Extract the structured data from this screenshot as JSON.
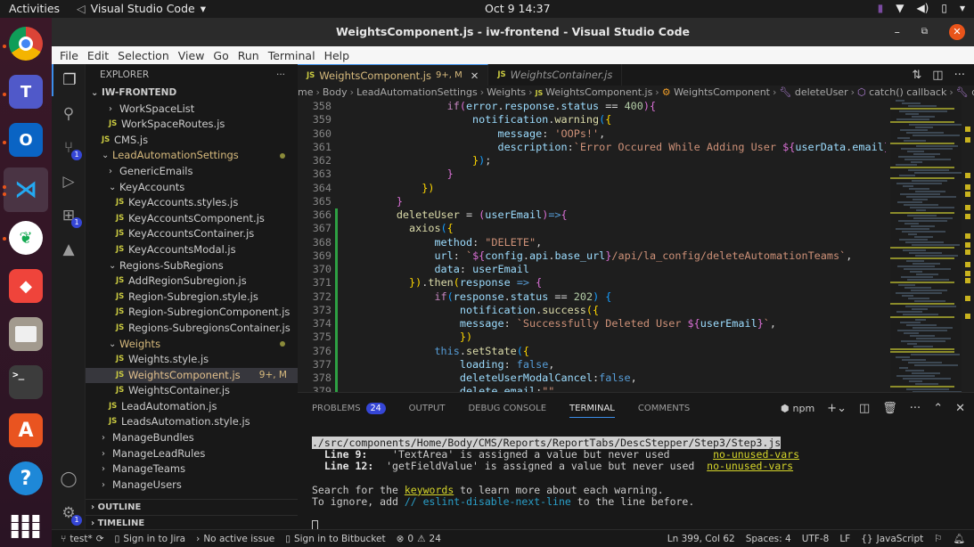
{
  "topbar": {
    "activities": "Activities",
    "app_name": "Visual Studio Code",
    "clock": "Oct 9  14:37"
  },
  "dock": {
    "items": [
      {
        "name": "chrome",
        "running": true
      },
      {
        "name": "teams",
        "running": true
      },
      {
        "name": "outlook",
        "running": true
      },
      {
        "name": "vscode",
        "running": true,
        "active": true
      },
      {
        "name": "mongodb-compass",
        "running": true
      },
      {
        "name": "anydesk",
        "running": false
      },
      {
        "name": "files",
        "running": false
      },
      {
        "name": "terminal",
        "running": false
      },
      {
        "name": "software-center",
        "running": false
      },
      {
        "name": "help",
        "running": false
      },
      {
        "name": "app-grid",
        "running": false
      }
    ]
  },
  "window": {
    "title": "WeightsComponent.js - iw-frontend - Visual Studio Code"
  },
  "menubar": [
    "File",
    "Edit",
    "Selection",
    "View",
    "Go",
    "Run",
    "Terminal",
    "Help"
  ],
  "activitybar": {
    "source_control_badge": "1",
    "extensions_badge": "1",
    "settings_badge": "1"
  },
  "sidebar": {
    "title": "EXPLORER",
    "more": "···",
    "root": "IW-FRONTEND",
    "tree": [
      {
        "label": "WorkSpaceList",
        "type": "folder",
        "open": false,
        "depth": 3
      },
      {
        "label": "WorkSpaceRoutes.js",
        "type": "file",
        "depth": 3
      },
      {
        "label": "CMS.js",
        "type": "file",
        "depth": 2
      },
      {
        "label": "LeadAutomationSettings",
        "type": "folder",
        "open": true,
        "depth": 2,
        "modified": true
      },
      {
        "label": "GenericEmails",
        "type": "folder",
        "open": false,
        "depth": 3
      },
      {
        "label": "KeyAccounts",
        "type": "folder",
        "open": true,
        "depth": 3
      },
      {
        "label": "KeyAccounts.styles.js",
        "type": "file",
        "depth": 4
      },
      {
        "label": "KeyAccountsComponent.js",
        "type": "file",
        "depth": 4
      },
      {
        "label": "KeyAccountsContainer.js",
        "type": "file",
        "depth": 4
      },
      {
        "label": "KeyAccountsModal.js",
        "type": "file",
        "depth": 4
      },
      {
        "label": "Regions-SubRegions",
        "type": "folder",
        "open": true,
        "depth": 3
      },
      {
        "label": "AddRegionSubregion.js",
        "type": "file",
        "depth": 4
      },
      {
        "label": "Region-Subregion.style.js",
        "type": "file",
        "depth": 4
      },
      {
        "label": "Region-SubregionComponent.js",
        "type": "file",
        "depth": 4
      },
      {
        "label": "Regions-SubregionsContainer.js",
        "type": "file",
        "depth": 4
      },
      {
        "label": "Weights",
        "type": "folder",
        "open": true,
        "depth": 3,
        "modified": true
      },
      {
        "label": "Weights.style.js",
        "type": "file",
        "depth": 4
      },
      {
        "label": "WeightsComponent.js",
        "type": "file",
        "depth": 4,
        "selected": true,
        "decoration": "9+, M"
      },
      {
        "label": "WeightsContainer.js",
        "type": "file",
        "depth": 4
      },
      {
        "label": "LeadAutomation.js",
        "type": "file",
        "depth": 3
      },
      {
        "label": "LeadsAutomation.style.js",
        "type": "file",
        "depth": 3
      },
      {
        "label": "ManageBundles",
        "type": "folder",
        "open": false,
        "depth": 2
      },
      {
        "label": "ManageLeadRules",
        "type": "folder",
        "open": false,
        "depth": 2
      },
      {
        "label": "ManageTeams",
        "type": "folder",
        "open": false,
        "depth": 2
      },
      {
        "label": "ManageUsers",
        "type": "folder",
        "open": false,
        "depth": 2
      }
    ],
    "sections": [
      "OUTLINE",
      "TIMELINE"
    ]
  },
  "editor": {
    "tabs": [
      {
        "label": "WeightsComponent.js",
        "decoration": "9+, M",
        "active": true,
        "close": "✕"
      },
      {
        "label": "WeightsContainer.js",
        "active": false
      }
    ],
    "breadcrumb": [
      "me",
      "Body",
      "LeadAutomationSettings",
      "Weights",
      "WeightsComponent.js",
      "WeightsComponent",
      "deleteUser",
      "catch() callback",
      "description"
    ],
    "lines": [
      {
        "n": "358",
        "mod": false,
        "html": "                <span class='k'>if</span><span class='b2'>(</span><span class='p'>error</span>.<span class='p'>response</span>.<span class='p'>status</span> == <span class='n'>400</span><span class='b2'>){</span>"
      },
      {
        "n": "359",
        "mod": false,
        "html": "                    <span class='p'>notification</span>.<span class='f'>warning</span><span class='b3'>(</span><span class='b1'>{</span>"
      },
      {
        "n": "360",
        "mod": false,
        "html": "                        <span class='p'>message</span>: <span class='s'>'OOPs!'</span>,"
      },
      {
        "n": "361",
        "mod": false,
        "html": "                        <span class='p'>description</span>:<span class='s'>`Error Occured While Adding User </span><span class='b2'>${</span><span class='p'>userData</span>.<span class='p'>email</span><span class='b2'>}</span><span class='s'>`</span>"
      },
      {
        "n": "362",
        "mod": false,
        "html": "                    <span class='b1'>}</span><span class='b3'>)</span>;"
      },
      {
        "n": "363",
        "mod": false,
        "html": "                <span class='b2'>}</span>"
      },
      {
        "n": "364",
        "mod": false,
        "html": "            <span class='b1'>})</span>"
      },
      {
        "n": "365",
        "mod": false,
        "html": "        <span class='b2'>}</span>"
      },
      {
        "n": "366",
        "mod": true,
        "html": "        <span class='f'>deleteUser</span> = <span class='b2'>(</span><span class='p'>userEmail</span><span class='b2'>)</span><span class='kw'>=></span><span class='b2'>{</span>"
      },
      {
        "n": "367",
        "mod": true,
        "html": "          <span class='f'>axios</span><span class='b3'>(</span><span class='b1'>{</span>"
      },
      {
        "n": "368",
        "mod": true,
        "html": "              <span class='p'>method</span>: <span class='s'>\"DELETE\"</span>,"
      },
      {
        "n": "369",
        "mod": true,
        "html": "              <span class='p'>url</span>: <span class='s'>`</span><span class='b2'>${</span><span class='p'>config</span>.<span class='p'>api</span>.<span class='p'>base_url</span><span class='b2'>}</span><span class='s'>/api/la_config/deleteAutomationTeams`</span>,"
      },
      {
        "n": "370",
        "mod": true,
        "html": "              <span class='p'>data</span>: <span class='p'>userEmail</span>"
      },
      {
        "n": "371",
        "mod": true,
        "html": "          <span class='b1'>})</span>.<span class='f'>then</span><span class='b1'>(</span><span class='p'>response</span> <span class='kw'>=></span> <span class='b2'>{</span>"
      },
      {
        "n": "372",
        "mod": true,
        "html": "              <span class='k'>if</span><span class='b3'>(</span><span class='p'>response</span>.<span class='p'>status</span> == <span class='n'>202</span><span class='b3'>)</span> <span class='b3'>{</span>"
      },
      {
        "n": "373",
        "mod": true,
        "html": "                  <span class='p'>notification</span>.<span class='f'>success</span><span class='b1'>({</span>"
      },
      {
        "n": "374",
        "mod": true,
        "html": "                  <span class='p'>message</span>: <span class='s'>`Successfully Deleted User </span><span class='b2'>${</span><span class='p'>userEmail</span><span class='b2'>}</span><span class='s'>`</span>,"
      },
      {
        "n": "375",
        "mod": true,
        "html": "                  <span class='b1'>})</span>"
      },
      {
        "n": "376",
        "mod": true,
        "html": "              <span class='kw'>this</span>.<span class='f'>setState</span><span class='b3'>(</span><span class='b1'>{</span>"
      },
      {
        "n": "377",
        "mod": true,
        "html": "                  <span class='p'>loading</span>: <span class='kw'>false</span>,"
      },
      {
        "n": "378",
        "mod": true,
        "html": "                  <span class='p'>deleteUserModalCancel</span>:<span class='kw'>false</span>,"
      },
      {
        "n": "379",
        "mod": true,
        "html": "                  <span class='p'>delete_email</span>:<span class='s'>\"\"</span>"
      }
    ]
  },
  "panel": {
    "tabs": [
      {
        "label": "PROBLEMS",
        "badge": "24"
      },
      {
        "label": "OUTPUT"
      },
      {
        "label": "DEBUG CONSOLE"
      },
      {
        "label": "TERMINAL",
        "active": true
      },
      {
        "label": "COMMENTS"
      }
    ],
    "terminal_name": "npm",
    "terminal": {
      "path": "./src/components/Home/Body/CMS/Reports/ReportTabs/DescStepper/Step3/Step3.js",
      "warnings": [
        {
          "line": "Line 9:",
          "msg": "'TextArea' is assigned a value but never used",
          "rule": "no-unused-vars"
        },
        {
          "line": "Line 12:",
          "msg": "'getFieldValue' is assigned a value but never used",
          "rule": "no-unused-vars"
        }
      ],
      "search_pre": "Search for the ",
      "search_kw": "keywords",
      "search_post": " to learn more about each warning.",
      "ignore_pre": "To ignore, add ",
      "ignore_cmt": "// eslint-disable-next-line",
      "ignore_post": " to the line before."
    }
  },
  "statusbar": {
    "branch": "test*",
    "jira": "Sign in to Jira",
    "issue": "No active issue",
    "bitbucket": "Sign in to Bitbucket",
    "errors": "0",
    "warnings": "24",
    "position": "Ln 399, Col 62",
    "spaces": "Spaces: 4",
    "encoding": "UTF-8",
    "eol": "LF",
    "language": "JavaScript"
  },
  "colors": {
    "accent": "#3b8eea",
    "modified": "#d7ba7d",
    "git_added": "#2ea043",
    "badge": "#3546d6",
    "ubuntu_orange": "#e9541a"
  }
}
